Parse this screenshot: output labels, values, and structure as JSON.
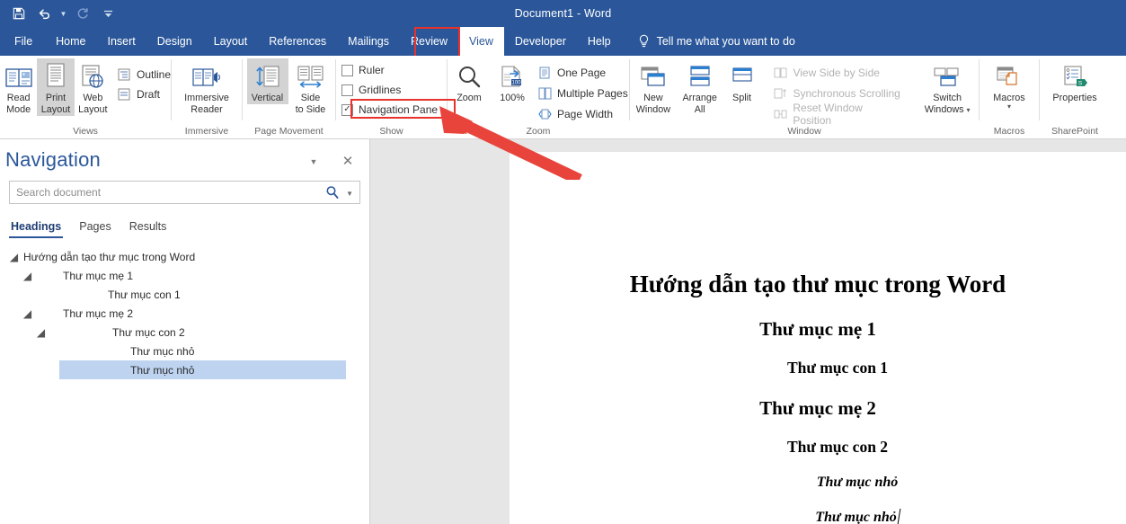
{
  "window": {
    "title": "Document1  -  Word",
    "accent_color": "#2b579a",
    "highlight_color": "#e8322a"
  },
  "quick_access": {
    "items": [
      {
        "name": "save-icon",
        "label": "Save"
      },
      {
        "name": "undo-icon",
        "label": "Undo"
      },
      {
        "name": "redo-icon",
        "label": "Redo"
      },
      {
        "name": "customize-quick-access-icon",
        "label": "Customize Quick Access Toolbar"
      }
    ]
  },
  "tabs": [
    {
      "label": "File",
      "active": false
    },
    {
      "label": "Home",
      "active": false
    },
    {
      "label": "Insert",
      "active": false
    },
    {
      "label": "Design",
      "active": false
    },
    {
      "label": "Layout",
      "active": false
    },
    {
      "label": "References",
      "active": false
    },
    {
      "label": "Mailings",
      "active": false
    },
    {
      "label": "Review",
      "active": false
    },
    {
      "label": "View",
      "active": true
    },
    {
      "label": "Developer",
      "active": false
    },
    {
      "label": "Help",
      "active": false
    }
  ],
  "tell_me": {
    "label": "Tell me what you want to do",
    "icon": "lightbulb-icon"
  },
  "ribbon": {
    "views": {
      "group_label": "Views",
      "buttons": [
        {
          "line1": "Read",
          "line2": "Mode",
          "selected": false
        },
        {
          "line1": "Print",
          "line2": "Layout",
          "selected": true
        },
        {
          "line1": "Web",
          "line2": "Layout",
          "selected": false
        }
      ],
      "small_items": [
        {
          "label": "Outline"
        },
        {
          "label": "Draft"
        }
      ]
    },
    "immersive": {
      "group_label": "Immersive",
      "button": {
        "line1": "Immersive",
        "line2": "Reader"
      }
    },
    "page_movement": {
      "group_label": "Page Movement",
      "buttons": [
        {
          "line1": "Vertical",
          "line2": "",
          "selected": true
        },
        {
          "line1": "Side",
          "line2": "to Side",
          "selected": false
        }
      ]
    },
    "show": {
      "group_label": "Show",
      "checkboxes": [
        {
          "label": "Ruler",
          "checked": false,
          "highlighted": false
        },
        {
          "label": "Gridlines",
          "checked": false,
          "highlighted": false
        },
        {
          "label": "Navigation Pane",
          "checked": true,
          "highlighted": true
        }
      ]
    },
    "zoom": {
      "group_label": "Zoom",
      "buttons": [
        {
          "line1": "Zoom",
          "line2": ""
        },
        {
          "line1": "100%",
          "line2": ""
        }
      ],
      "small_items": [
        {
          "label": "One Page",
          "icon": "one-page-icon"
        },
        {
          "label": "Multiple Pages",
          "icon": "multiple-pages-icon"
        },
        {
          "label": "Page Width",
          "icon": "page-width-icon"
        }
      ]
    },
    "window": {
      "group_label": "Window",
      "buttons": [
        {
          "line1": "New",
          "line2": "Window"
        },
        {
          "line1": "Arrange",
          "line2": "All"
        },
        {
          "line1": "Split",
          "line2": ""
        }
      ],
      "small_items": [
        {
          "label": "View Side by Side",
          "disabled": true,
          "icon": "side-by-side-icon"
        },
        {
          "label": "Synchronous Scrolling",
          "disabled": true,
          "icon": "sync-scroll-icon"
        },
        {
          "label": "Reset Window Position",
          "disabled": true,
          "icon": "reset-window-icon"
        }
      ],
      "switch_windows": {
        "line1": "Switch",
        "line2": "Windows"
      }
    },
    "macros": {
      "group_label": "Macros",
      "button": {
        "line1": "Macros",
        "line2": ""
      }
    },
    "sharepoint": {
      "group_label": "SharePoint",
      "button": {
        "line1": "Properties",
        "line2": ""
      }
    }
  },
  "navigation_pane": {
    "title": "Navigation",
    "collapse_icon": "chevron-down-icon",
    "close_icon": "close-icon",
    "search": {
      "placeholder": "Search document",
      "value": "",
      "search_icon": "search-icon",
      "dropdown_icon": "chevron-down-icon"
    },
    "tabs": [
      {
        "label": "Headings",
        "active": true
      },
      {
        "label": "Pages",
        "active": false
      },
      {
        "label": "Results",
        "active": false
      }
    ],
    "headings": [
      {
        "label": "Hướng dẫn tạo thư mục trong Word",
        "level": 0,
        "expander": true,
        "selected": false
      },
      {
        "label": "Thư mục mẹ 1",
        "level": 1,
        "expander": true,
        "selected": false
      },
      {
        "label": "Thư mục con 1",
        "level": 2,
        "expander": false,
        "selected": false
      },
      {
        "label": "Thư mục mẹ 2",
        "level": 1,
        "expander": true,
        "selected": false
      },
      {
        "label": "Thư mục con 2",
        "level": 2,
        "expander": true,
        "selected": false
      },
      {
        "label": "Thư mục nhỏ",
        "level": 3,
        "expander": false,
        "selected": false
      },
      {
        "label": "Thư mục nhỏ",
        "level": 3,
        "expander": false,
        "selected": true
      }
    ]
  },
  "document": {
    "lines": [
      {
        "text": "Hướng dẫn tạo thư mục trong Word",
        "style": "title"
      },
      {
        "text": "Thư mục mẹ 1",
        "style": "h1"
      },
      {
        "text": "Thư mục con 1",
        "style": "h2"
      },
      {
        "text": "Thư mục mẹ 2",
        "style": "h1"
      },
      {
        "text": "Thư mục con 2",
        "style": "h2"
      },
      {
        "text": "Thư mục nhỏ",
        "style": "h3"
      },
      {
        "text": "Thư mục nhỏ",
        "style": "h3-caret"
      }
    ]
  },
  "annotations": {
    "arrow": {
      "color": "#e8443c",
      "points_to": "Navigation Pane checkbox"
    },
    "boxes": [
      {
        "target": "View tab",
        "color": "#e8322a"
      },
      {
        "target": "Navigation Pane checkbox",
        "color": "#e8322a"
      }
    ]
  }
}
